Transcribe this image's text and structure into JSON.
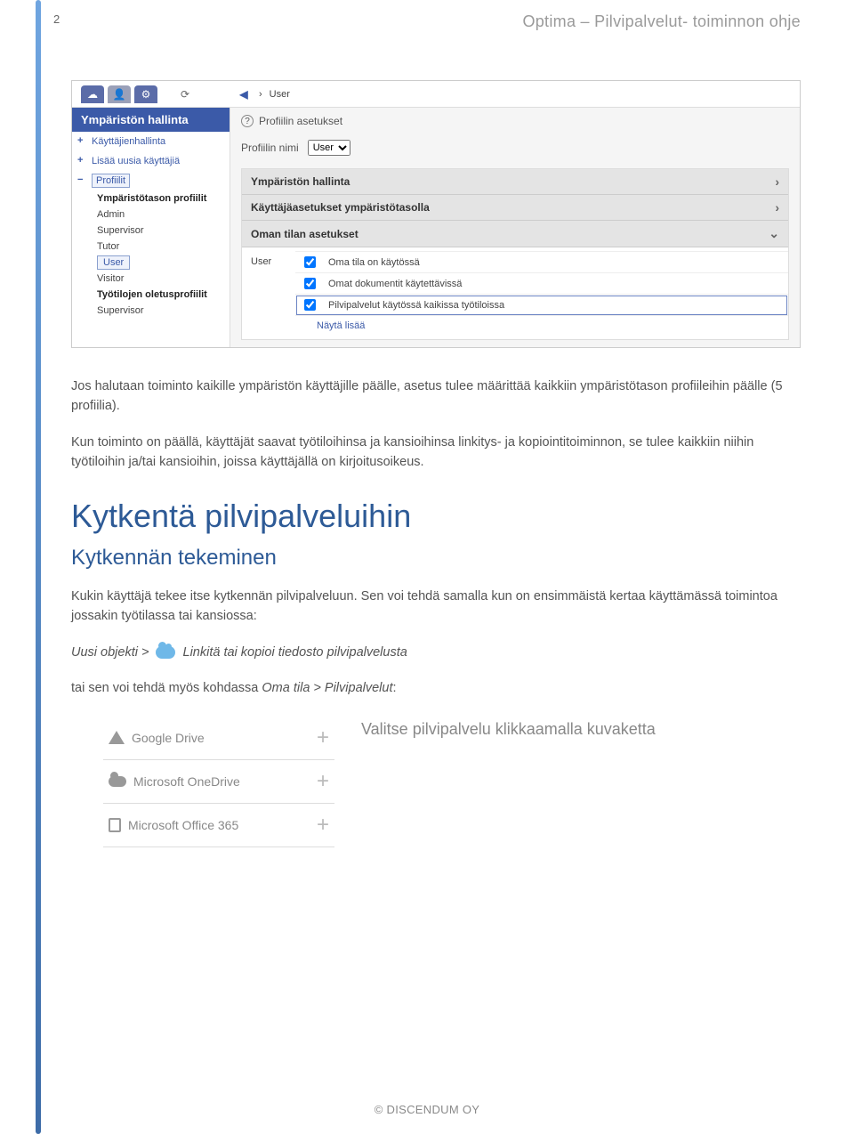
{
  "header": {
    "page_number": "2",
    "doc_title": "Optima – Pilvipalvelut- toiminnon ohje"
  },
  "ui": {
    "topbar": {
      "breadcrumb": "User"
    },
    "sidebar": {
      "title": "Ympäristön hallinta",
      "items": [
        {
          "label": "Käyttäjienhallinta"
        },
        {
          "label": "Lisää uusia käyttäjiä"
        },
        {
          "label": "Profiilit"
        }
      ],
      "group1_title": "Ympäristötason profiilit",
      "group1": [
        "Admin",
        "Supervisor",
        "Tutor",
        "User",
        "Visitor"
      ],
      "group2_title": "Työtilojen oletusprofiilit",
      "group2": [
        "Supervisor"
      ]
    },
    "main": {
      "profile_settings_label": "Profiilin asetukset",
      "profile_name_label": "Profiilin nimi",
      "profile_name_value": "User",
      "accordion": [
        {
          "label": "Ympäristön hallinta"
        },
        {
          "label": "Käyttäjäasetukset ympäristötasolla"
        },
        {
          "label": "Oman tilan asetukset"
        }
      ],
      "user_label": "User",
      "checkboxes": [
        "Oma tila on käytössä",
        "Omat dokumentit käytettävissä",
        "Pilvipalvelut käytössä kaikissa työtiloissa"
      ],
      "show_more": "Näytä lisää"
    }
  },
  "body": {
    "p1": "Jos halutaan toiminto kaikille ympäristön käyttäjille päälle, asetus tulee määrittää kaikkiin ympäristötason profiileihin päälle (5 profiilia).",
    "p2": "Kun toiminto on päällä, käyttäjät saavat työtiloihinsa ja kansioihinsa linkitys- ja kopiointitoiminnon, se tulee kaikkiin niihin työtiloihin ja/tai kansioihin, joissa käyttäjällä on kirjoitusoikeus.",
    "h1": "Kytkentä pilvipalveluihin",
    "h2": "Kytkennän tekeminen",
    "p3": "Kukin käyttäjä tekee itse kytkennän pilvipalveluun. Sen voi tehdä samalla kun on ensimmäistä kertaa käyttämässä toimintoa jossakin työtilassa tai kansiossa:",
    "path_prefix": "Uusi objekti >",
    "path_suffix": "Linkitä tai kopioi tiedosto pilvipalvelusta",
    "p4_a": "tai sen voi tehdä myös kohdassa ",
    "p4_b": "Oma tila > Pilvipalvelut",
    "p4_c": ":"
  },
  "cloud": {
    "services": [
      "Google Drive",
      "Microsoft OneDrive",
      "Microsoft Office 365"
    ],
    "hint": "Valitse pilvipalvelu klikkaamalla kuvaketta"
  },
  "footer": "© DISCENDUM OY"
}
